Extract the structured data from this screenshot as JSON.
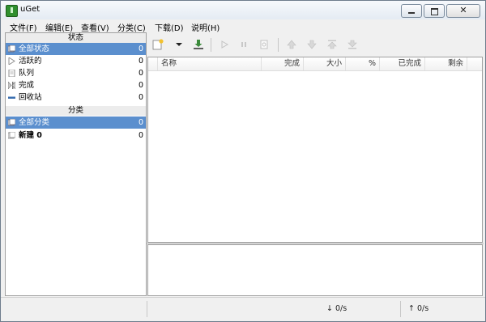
{
  "window": {
    "title": "uGet"
  },
  "menu": [
    "文件(F)",
    "编辑(E)",
    "查看(V)",
    "分类(C)",
    "下载(D)",
    "说明(H)"
  ],
  "status_section": {
    "header": "状态",
    "items": [
      {
        "label": "全部状态",
        "count": "0",
        "icon": "all-status-icon",
        "selected": true
      },
      {
        "label": "活跃的",
        "count": "0",
        "icon": "active-icon",
        "selected": false
      },
      {
        "label": "队列",
        "count": "0",
        "icon": "queue-icon",
        "selected": false
      },
      {
        "label": "完成",
        "count": "0",
        "icon": "finished-icon",
        "selected": false
      },
      {
        "label": "回收站",
        "count": "0",
        "icon": "recycle-icon",
        "selected": false
      }
    ]
  },
  "category_section": {
    "header": "分类",
    "items": [
      {
        "label": "全部分类",
        "count": "0",
        "icon": "all-category-icon",
        "selected": true
      },
      {
        "label": "新建 0",
        "count": "0",
        "icon": "category-icon",
        "selected": false
      }
    ]
  },
  "toolbar": {
    "buttons": [
      "new-download-icon",
      "dropdown-icon",
      "batch-download-icon",
      "start-icon",
      "pause-icon",
      "properties-icon",
      "move-up-icon",
      "move-down-icon",
      "move-top-icon",
      "move-bottom-icon"
    ]
  },
  "columns": [
    "名称",
    "完成",
    "大小",
    "%",
    "已完成",
    "剩余"
  ],
  "status_bar": {
    "download_speed": "↓ 0/s",
    "upload_speed": "↑ 0/s"
  },
  "colors": {
    "selection": "#5b8fce",
    "panel_bg": "#ffffff",
    "window_bg": "#f0f0f0"
  }
}
